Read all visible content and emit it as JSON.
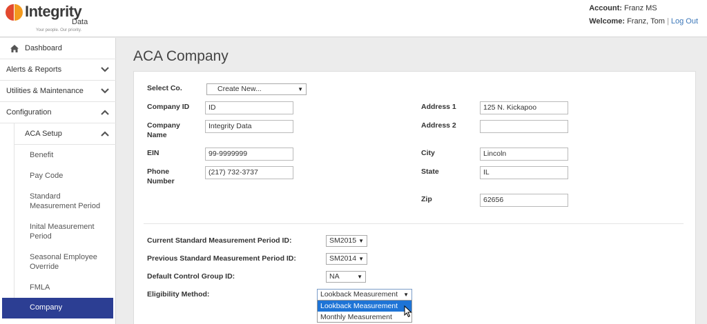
{
  "logo": {
    "name": "Integrity",
    "sub": "Data",
    "tagline": "Your people. Our priority.",
    "colors": {
      "left": "#e2492f",
      "right": "#f39a1e"
    }
  },
  "account": {
    "account_label": "Account:",
    "account_value": "Franz MS",
    "welcome_label": "Welcome:",
    "user_name": "Franz, Tom",
    "separator": "|",
    "logout": "Log Out"
  },
  "sidebar": {
    "dashboard": "Dashboard",
    "alerts": "Alerts & Reports",
    "utilities": "Utilities & Maintenance",
    "configuration": "Configuration",
    "aca_setup": "ACA Setup",
    "benefit": "Benefit",
    "pay_code": "Pay Code",
    "standard_line1": "Standard",
    "standard_line2": "Measurement Period",
    "initial_line1": "Inital Measurement",
    "initial_line2": "Period",
    "seasonal_line1": "Seasonal Employee",
    "seasonal_line2": "Override",
    "fmla": "FMLA",
    "company": "Company",
    "active_color": "#2c3e93"
  },
  "page": {
    "title": "ACA Company"
  },
  "form": {
    "select_co_label": "Select Co.",
    "select_co_value": "Create New...",
    "company_id_label": "Company ID",
    "company_id_value": "ID",
    "company_name_line1": "Company",
    "company_name_line2": "Name",
    "company_name_value": "Integrity Data",
    "ein_label": "EIN",
    "ein_value": "99-9999999",
    "phone_line1": "Phone",
    "phone_line2": "Number",
    "phone_value": "(217) 732-3737",
    "address1_label": "Address 1",
    "address1_value": "125 N. Kickapoo",
    "address2_label": "Address 2",
    "address2_value": "",
    "city_label": "City",
    "city_value": "Lincoln",
    "state_label": "State",
    "state_value": "IL",
    "zip_label": "Zip",
    "zip_value": "62656",
    "current_smp_label": "Current Standard Measurement Period ID:",
    "current_smp_value": "SM2015",
    "previous_smp_label": "Previous Standard Measurement Period ID:",
    "previous_smp_value": "SM2014",
    "control_group_label": "Default Control Group ID:",
    "control_group_value": "NA",
    "eligibility_label": "Eligibility Method:",
    "eligibility_value": "Lookback Measurement",
    "eligibility_options": [
      "Lookback Measurement",
      "Monthly Measurement"
    ],
    "dropdown_highlight": "#1e74d6"
  }
}
